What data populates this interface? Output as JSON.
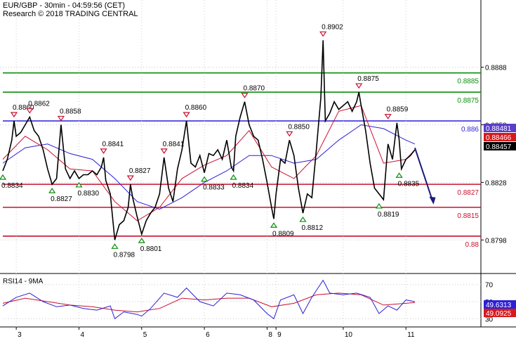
{
  "header": {
    "line1": "EUR/GBP - 30min - 04:59:56 (CET)",
    "line2": "Research © 2018 TRADING CENTRAL"
  },
  "chart_data": [
    {
      "type": "line",
      "name": "main",
      "ylim": [
        0.8782,
        0.8912
      ],
      "xlim": [
        0,
        100
      ],
      "y_ticks": [
        "0.8888",
        "0.8858",
        "0.8828",
        "0.8798"
      ],
      "x_ticks": [
        {
          "label": "3",
          "x": 3
        },
        {
          "label": "4",
          "x": 17
        },
        {
          "label": "5",
          "x": 31
        },
        {
          "label": "6",
          "x": 45
        },
        {
          "label": "8",
          "x": 59
        },
        {
          "label": "9",
          "x": 61
        },
        {
          "label": "10",
          "x": 76
        },
        {
          "label": "11",
          "x": 90
        }
      ],
      "levels": [
        {
          "value": 0.8885,
          "label": "0.8885",
          "color": "#0a8f0a"
        },
        {
          "value": 0.8875,
          "label": "0.8875",
          "color": "#0a8f0a"
        },
        {
          "value": 0.886,
          "label": "0.886",
          "color": "#2c1fd6"
        },
        {
          "value": 0.8827,
          "label": "0.8827",
          "color": "#c8102e"
        },
        {
          "value": 0.8815,
          "label": "0.8815",
          "color": "#c8102e"
        },
        {
          "value": 0.88,
          "label": "0.88",
          "color": "#c8102e"
        }
      ],
      "price_badges": [
        {
          "label": "0.88481",
          "color": "#5a3ec8",
          "value": 0.88481
        },
        {
          "label": "0.88466",
          "color": "#d7191c",
          "value": 0.88466
        },
        {
          "label": "0.88457",
          "color": "#000000",
          "value": 0.88457
        }
      ],
      "highs": [
        {
          "x": 2.5,
          "value": 0.886,
          "label": "0.8860"
        },
        {
          "x": 6,
          "value": 0.8862,
          "label": "0.8862"
        },
        {
          "x": 13,
          "value": 0.8858,
          "label": "0.8858"
        },
        {
          "x": 22.5,
          "value": 0.8841,
          "label": "0.8841"
        },
        {
          "x": 28.5,
          "value": 0.8827,
          "label": "0.8827"
        },
        {
          "x": 36,
          "value": 0.8841,
          "label": "0.8841"
        },
        {
          "x": 41,
          "value": 0.886,
          "label": "0.8860"
        },
        {
          "x": 54,
          "value": 0.887,
          "label": "0.8870"
        },
        {
          "x": 64,
          "value": 0.885,
          "label": "0.8850"
        },
        {
          "x": 71.5,
          "value": 0.8902,
          "label": "0.8902"
        },
        {
          "x": 79.5,
          "value": 0.8875,
          "label": "0.8875"
        },
        {
          "x": 86,
          "value": 0.8859,
          "label": "0.8859"
        }
      ],
      "lows": [
        {
          "x": 0,
          "value": 0.8834,
          "label": "0.8834"
        },
        {
          "x": 11,
          "value": 0.8827,
          "label": "0.8827"
        },
        {
          "x": 17,
          "value": 0.883,
          "label": "0.8830"
        },
        {
          "x": 25,
          "value": 0.8798,
          "label": "0.8798"
        },
        {
          "x": 31,
          "value": 0.8801,
          "label": "0.8801"
        },
        {
          "x": 45,
          "value": 0.8833,
          "label": "0.8833"
        },
        {
          "x": 51.5,
          "value": 0.8834,
          "label": "0.8834"
        },
        {
          "x": 60.5,
          "value": 0.8809,
          "label": "0.8809"
        },
        {
          "x": 67,
          "value": 0.8812,
          "label": "0.8812"
        },
        {
          "x": 84,
          "value": 0.8819,
          "label": "0.8819"
        },
        {
          "x": 88.5,
          "value": 0.8835,
          "label": "0.8835"
        }
      ],
      "price": {
        "x": [
          0,
          1,
          2,
          2.5,
          3,
          4,
          5,
          6,
          7,
          8,
          9,
          10,
          11,
          12,
          13,
          14,
          15,
          16,
          17,
          18,
          19,
          20,
          21,
          22,
          22.5,
          23,
          24,
          25,
          26,
          27,
          28,
          28.5,
          29,
          30,
          31,
          32,
          33,
          34,
          35,
          36,
          37,
          38,
          39,
          40,
          41,
          42,
          43,
          44,
          45,
          46,
          47,
          48,
          49,
          50,
          51,
          51.5,
          52,
          53,
          54,
          55,
          56,
          57,
          58,
          59,
          60,
          60.5,
          61,
          62,
          63,
          64,
          65,
          66,
          67,
          68,
          69,
          70,
          71,
          71.5,
          72,
          73,
          74,
          75,
          76,
          77,
          78,
          79,
          79.5,
          80,
          81,
          82,
          83,
          84,
          85,
          86,
          87,
          88,
          88.5,
          89,
          90,
          91,
          92
        ],
        "y": [
          0.8834,
          0.884,
          0.885,
          0.886,
          0.8852,
          0.8854,
          0.8858,
          0.8862,
          0.8855,
          0.8852,
          0.8845,
          0.8835,
          0.8827,
          0.883,
          0.8858,
          0.8835,
          0.883,
          0.8834,
          0.883,
          0.8832,
          0.8832,
          0.8834,
          0.8832,
          0.8836,
          0.8841,
          0.8829,
          0.8822,
          0.8798,
          0.8806,
          0.8808,
          0.8815,
          0.8827,
          0.882,
          0.881,
          0.8801,
          0.8808,
          0.8812,
          0.8815,
          0.8822,
          0.8841,
          0.8825,
          0.8818,
          0.8835,
          0.8845,
          0.886,
          0.8838,
          0.8836,
          0.8842,
          0.8833,
          0.8843,
          0.8842,
          0.8845,
          0.884,
          0.885,
          0.8836,
          0.8834,
          0.8852,
          0.8862,
          0.887,
          0.8858,
          0.8852,
          0.885,
          0.884,
          0.8828,
          0.8815,
          0.8809,
          0.8822,
          0.884,
          0.8838,
          0.885,
          0.8842,
          0.8825,
          0.8812,
          0.8822,
          0.882,
          0.8845,
          0.8872,
          0.8902,
          0.886,
          0.8864,
          0.887,
          0.8866,
          0.8868,
          0.887,
          0.8865,
          0.887,
          0.8875,
          0.8868,
          0.8855,
          0.8838,
          0.8825,
          0.8822,
          0.8819,
          0.8848,
          0.884,
          0.8859,
          0.885,
          0.8835,
          0.884,
          0.8842,
          0.8845,
          0.8848,
          0.8846
        ]
      },
      "ma_fast": {
        "x": [
          0,
          5,
          10,
          15,
          20,
          25,
          30,
          35,
          40,
          45,
          50,
          55,
          60,
          65,
          70,
          75,
          80,
          85,
          90,
          92
        ],
        "y": [
          0.884,
          0.8852,
          0.8845,
          0.8835,
          0.8834,
          0.8818,
          0.8808,
          0.8815,
          0.883,
          0.8837,
          0.8842,
          0.8855,
          0.8836,
          0.883,
          0.8842,
          0.8865,
          0.8868,
          0.8838,
          0.884,
          0.8845
        ]
      },
      "ma_slow": {
        "x": [
          0,
          5,
          10,
          15,
          20,
          25,
          30,
          35,
          40,
          45,
          50,
          55,
          60,
          65,
          70,
          75,
          80,
          85,
          90,
          92
        ],
        "y": [
          0.8838,
          0.8846,
          0.8848,
          0.8843,
          0.884,
          0.883,
          0.8818,
          0.8814,
          0.882,
          0.8828,
          0.8834,
          0.8842,
          0.8842,
          0.8838,
          0.884,
          0.885,
          0.8858,
          0.8856,
          0.885,
          0.8848
        ]
      },
      "projection": {
        "x": [
          92,
          96
        ],
        "y": [
          0.8846,
          0.8818
        ]
      }
    },
    {
      "type": "line",
      "name": "rsi",
      "title": "RSI14 - 9MA",
      "ylim": [
        22,
        78
      ],
      "y_ticks": [
        "70",
        "50",
        "30"
      ],
      "guides": [
        70,
        50,
        30
      ],
      "badges": [
        {
          "label": "49.6313",
          "color": "#2c1fd6",
          "value": 49.6313
        },
        {
          "label": "49.0925",
          "color": "#d7191c",
          "value": 46.5
        }
      ],
      "rsi": {
        "x": [
          0,
          3,
          6,
          9,
          12,
          15,
          18,
          21,
          24,
          25,
          27,
          30,
          31,
          33,
          36,
          39,
          41,
          44,
          47,
          50,
          53,
          56,
          59,
          60.5,
          62,
          65,
          67,
          69,
          71.5,
          73,
          76,
          79,
          82,
          84,
          86,
          88,
          90,
          92
        ],
        "y": [
          45,
          55,
          60,
          50,
          44,
          46,
          42,
          40,
          45,
          30,
          38,
          35,
          33,
          42,
          60,
          55,
          66,
          50,
          45,
          60,
          58,
          52,
          36,
          30,
          52,
          58,
          36,
          55,
          75,
          60,
          58,
          60,
          55,
          36,
          45,
          40,
          52,
          50
        ]
      },
      "ma": {
        "x": [
          0,
          5,
          10,
          15,
          20,
          25,
          30,
          35,
          40,
          45,
          50,
          55,
          60,
          65,
          70,
          75,
          80,
          85,
          90,
          92
        ],
        "y": [
          48,
          54,
          50,
          46,
          44,
          40,
          38,
          42,
          54,
          52,
          54,
          54,
          44,
          48,
          58,
          60,
          58,
          46,
          48,
          49
        ]
      }
    }
  ]
}
